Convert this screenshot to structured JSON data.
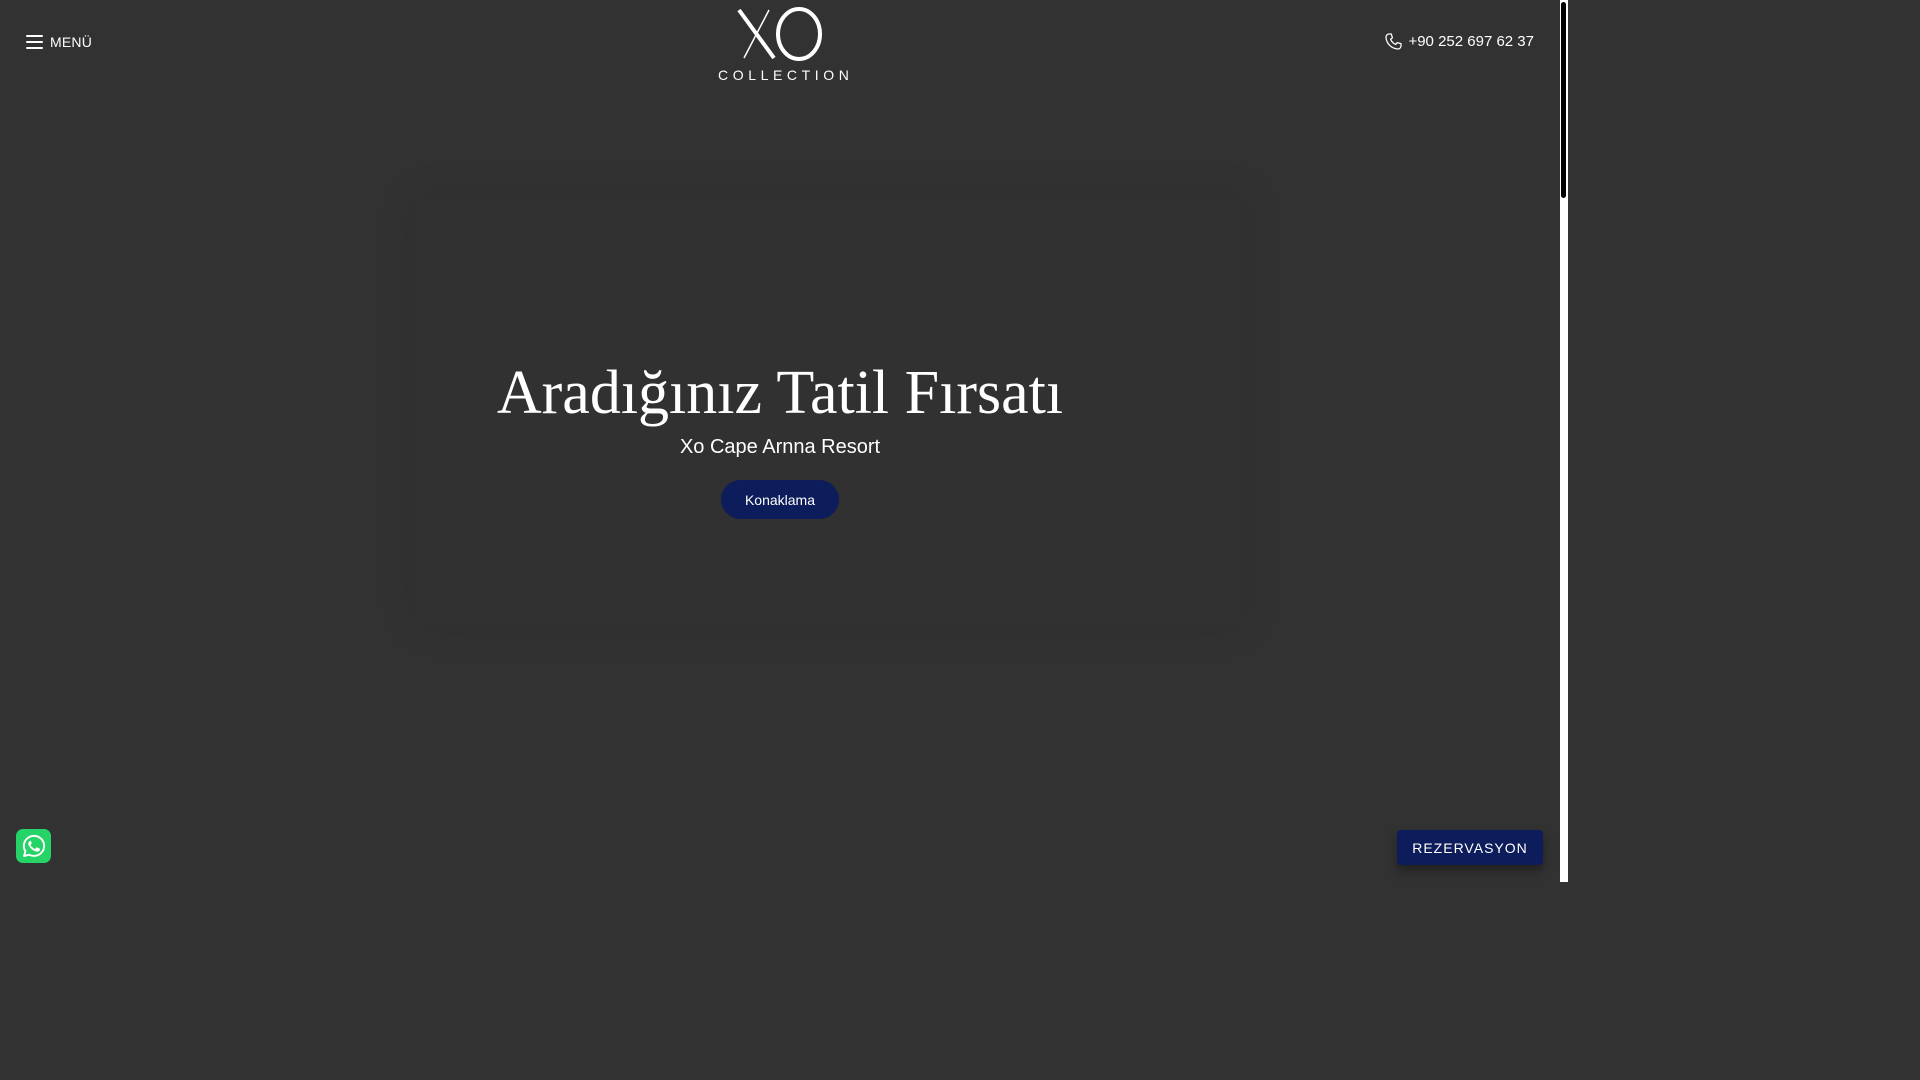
{
  "header": {
    "menu_label": "MENÜ",
    "menu_icon": "hamburger-icon",
    "logo": {
      "monogram": "XO",
      "wordmark": "COLLECTION"
    },
    "phone_icon": "phone-icon",
    "phone_number": "+90 252 697 62 37"
  },
  "hero": {
    "title": "Aradığınız Tatil Fırsatı",
    "subtitle": "Xo Cape Arnna Resort",
    "button_label": "Konaklama"
  },
  "floating": {
    "whatsapp_icon": "whatsapp-icon",
    "reserve_label": "REZERVASYON"
  },
  "colors": {
    "background": "#323232",
    "accent_navy": "#0d1c5a",
    "whatsapp_green": "#25d366",
    "text": "#ffffff"
  }
}
